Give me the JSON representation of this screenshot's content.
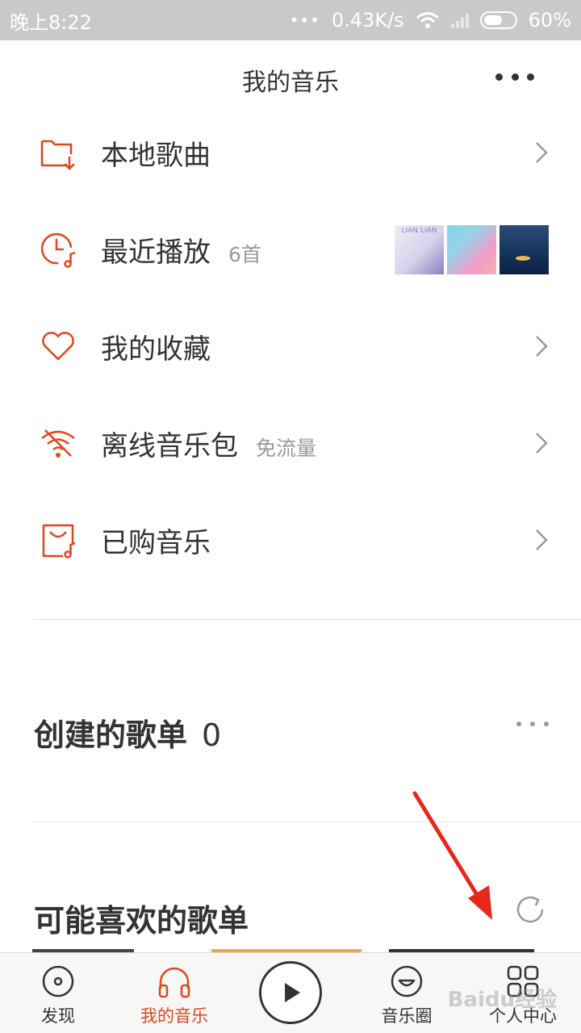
{
  "status_bar": {
    "time": "晚上8:22",
    "speed": "0.43K/s",
    "battery": "60%"
  },
  "header": {
    "title": "我的音乐"
  },
  "menu": [
    {
      "label": "本地歌曲",
      "sub": "",
      "icon": "folder-download-icon"
    },
    {
      "label": "最近播放",
      "sub": "6首",
      "icon": "clock-music-icon"
    },
    {
      "label": "我的收藏",
      "sub": "",
      "icon": "heart-icon"
    },
    {
      "label": "离线音乐包",
      "sub": "免流量",
      "icon": "wifi-offline-icon"
    },
    {
      "label": "已购音乐",
      "sub": "",
      "icon": "shopping-bag-music-icon"
    }
  ],
  "recent_thumbs": {
    "thumb1_text": "LIAN LIAN"
  },
  "created_playlists": {
    "title": "创建的歌单",
    "count": "0"
  },
  "recommended_playlists": {
    "title": "可能喜欢的歌单"
  },
  "bottom_nav": {
    "discover": "发现",
    "my_music": "我的音乐",
    "circle": "音乐圈",
    "profile": "个人中心"
  },
  "watermark": "Baidu经验",
  "colors": {
    "accent": "#e0461c",
    "text": "#333333",
    "muted": "#999999",
    "annotation": "#e8271b"
  }
}
